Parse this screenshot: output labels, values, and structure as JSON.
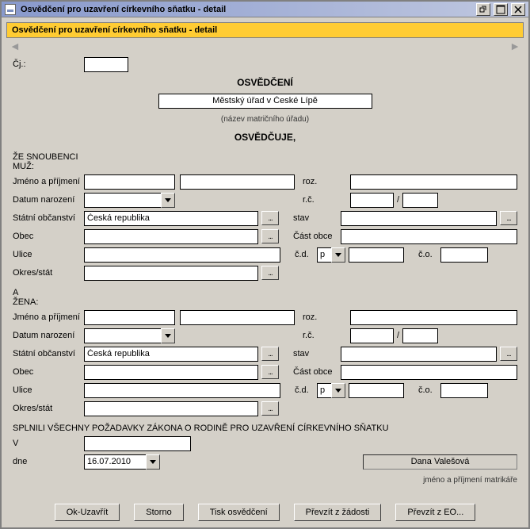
{
  "window": {
    "title": "Osvědčení pro uzavření církevního sňatku - detail"
  },
  "subheader": "Osvědčení pro uzavření církevního sňatku - detail",
  "cj_label": "Čj.:",
  "cj_value": "",
  "heading1": "OSVĚDČENÍ",
  "office": "Městský úřad v České Lípě",
  "office_sub": "(název matričního úřadu)",
  "heading2": "OSVĚDČUJE,",
  "fiances_label": "ŽE SNOUBENCI",
  "man_label": "MUŽ:",
  "and_label": "A",
  "woman_label": "ŽENA:",
  "labels": {
    "name": "Jméno a příjmení",
    "nee": "roz.",
    "dob": "Datum narození",
    "rc": "r.č.",
    "rc_sep": "/",
    "citizenship": "Státní občanství",
    "status": "stav",
    "town": "Obec",
    "townpart": "Část obce",
    "street": "Ulice",
    "cd": "č.d.",
    "co": "č.o.",
    "district": "Okres/stát"
  },
  "man": {
    "firstname": "",
    "surname": "",
    "nee": "",
    "dob": "",
    "rc1": "",
    "rc2": "",
    "citizenship": "Česká republika",
    "status": "",
    "town": "",
    "townpart": "",
    "street": "",
    "cd_type": "p",
    "cd": "",
    "co": "",
    "district": ""
  },
  "woman": {
    "firstname": "",
    "surname": "",
    "nee": "",
    "dob": "",
    "rc1": "",
    "rc2": "",
    "citizenship": "Česká republika",
    "status": "",
    "town": "",
    "townpart": "",
    "street": "",
    "cd_type": "p",
    "cd": "",
    "co": "",
    "district": ""
  },
  "fulfilled_text": "SPLNILI VŠECHNY POŽADAVKY ZÁKONA O RODINĚ PRO UZAVŘENÍ CÍRKEVNÍHO SŇATKU",
  "v_label": "V",
  "v_value": "",
  "dne_label": "dne",
  "dne_value": "16.07.2010",
  "signer": "Dana Valešová",
  "signer_sub": "jméno a příjmení matrikáře",
  "lookup_label": "...",
  "buttons": {
    "ok": "Ok-Uzavřít",
    "cancel": "Storno",
    "print": "Tisk osvědčení",
    "take_req": "Převzít z žádosti",
    "take_eo": "Převzít z EO..."
  }
}
